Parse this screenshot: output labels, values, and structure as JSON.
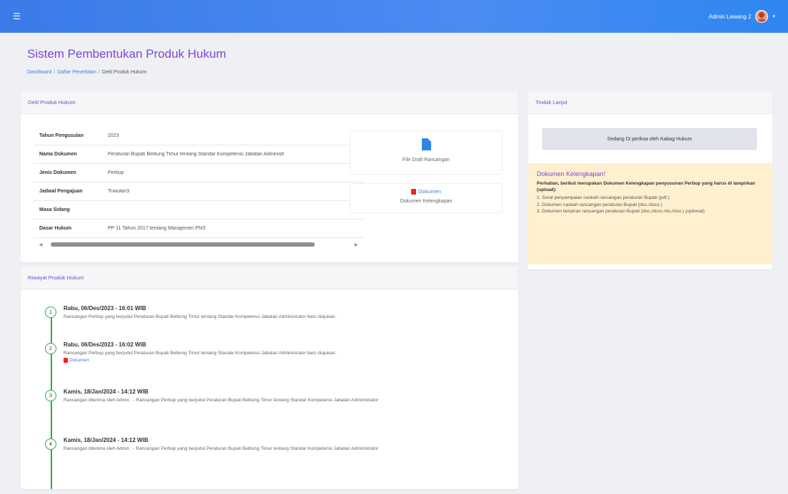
{
  "topbar": {
    "menu_icon": "hamburger-icon",
    "user_name": "Admin Lawang 2",
    "caret": "▾"
  },
  "page": {
    "title": "Sistem Pembentukan Produk Hukum",
    "breadcrumb": [
      "Dashboard",
      "Daftar Penerbitan",
      "Detil Produk Hukum"
    ],
    "breadcrumb_sep": "/"
  },
  "detil": {
    "header": "Detil Produk Hukum",
    "rows": [
      {
        "k": "Tahun Pengusulan",
        "v": "2023"
      },
      {
        "k": "Nama Dokumen",
        "v": "Peraturan Bupati Belitung Timur tentang Standar Kompetensi Jabatan Administr"
      },
      {
        "k": "Jenis Dokumen",
        "v": "Perbup"
      },
      {
        "k": "Jadwal Pengajuan",
        "v": "Triwulan3"
      },
      {
        "k": "Masa Sidang",
        "v": ""
      },
      {
        "k": "Dasar Hukum",
        "v": "PP 11 Tahun 2017 tentang Manajemen PNS"
      }
    ],
    "scroll_left": "◀",
    "scroll_right": "▶",
    "draft_label": "File Draft Rancangan",
    "dok_link": "Dokumen",
    "dok_label": "Dokumen Kelengkapan"
  },
  "tindak": {
    "header": "Tindak Lanjut",
    "status": "Sedang Di periksa oleh Kabag Hukum",
    "warn_title": "Dokumen Kelengkapan!",
    "warn_intro": "Perhatian, berikut merupakan Dokumen Kelengkapan penyusunan Perbup yang harus di lampirkan (upload):",
    "warn_items": [
      "1. Surat penyampaian naskah rancangan peraturan Bupati (pdf.)",
      "2. Dokumen naskah rancangan peraturan Bupati (doc./docx.)",
      "3. Dokumen lampiran rancangan peraturan Bupati (doc./docx./xls./xlsx.) (optional)"
    ]
  },
  "riwayat": {
    "header": "Riwayat Produk Hukum",
    "items": [
      {
        "num": "1",
        "date": "Rabu, 06/Des/2023 - 16:01 WIB",
        "desc": "Rancangan Perbup yang berjudul Peraturan Bupati Belitung Timur tentang Standar Kompetensi Jabatan Administrator baru diajukan.",
        "doc": ""
      },
      {
        "num": "2",
        "date": "Rabu, 06/Des/2023 - 16:02 WIB",
        "desc": "Rancangan Perbup yang berjudul Peraturan Bupati Belitung Timur tentang Standar Kompetensi Jabatan Administrator baru diajukan.",
        "doc": "Dokumen"
      },
      {
        "num": "3",
        "date": "Kamis, 18/Jan/2024 - 14:12 WIB",
        "desc": "Rancangan diterima oleh Admin : - Rancangan Perbup yang berjudul Peraturan Bupati Belitung Timur tentang Standar Kompetensi Jabatan Administrator",
        "doc": ""
      },
      {
        "num": "4",
        "date": "Kamis, 18/Jan/2024 - 14:12 WIB",
        "desc": "Rancangan diterima oleh Admin : - Rancangan Perbup yang berjudul Peraturan Bupati Belitung Timur tentang Standar Kompetensi Jabatan Administrator",
        "doc": ""
      }
    ]
  },
  "colors": {
    "accent": "#7d47d6",
    "topbar": "#3a7be8",
    "timeline": "#2ea84a",
    "link": "#3d82e6",
    "warning_bg": "#fff1cf"
  }
}
